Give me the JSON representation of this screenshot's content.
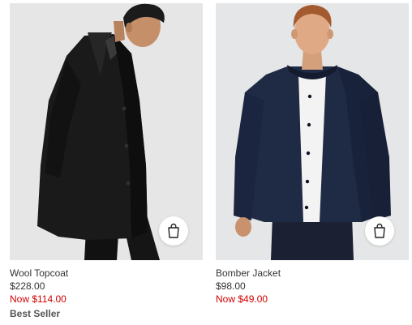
{
  "products": [
    {
      "name": "Wool Topcoat",
      "price": "$228.00",
      "sale_price": "Now $114.00",
      "badge": "Best Seller",
      "image_icon": "shopping-bag-icon"
    },
    {
      "name": "Bomber Jacket",
      "price": "$98.00",
      "sale_price": "Now $49.00",
      "image_icon": "shopping-bag-icon"
    }
  ],
  "colors": {
    "sale": "#d00000",
    "text": "#333333",
    "image_bg": "#e6e6e6"
  }
}
